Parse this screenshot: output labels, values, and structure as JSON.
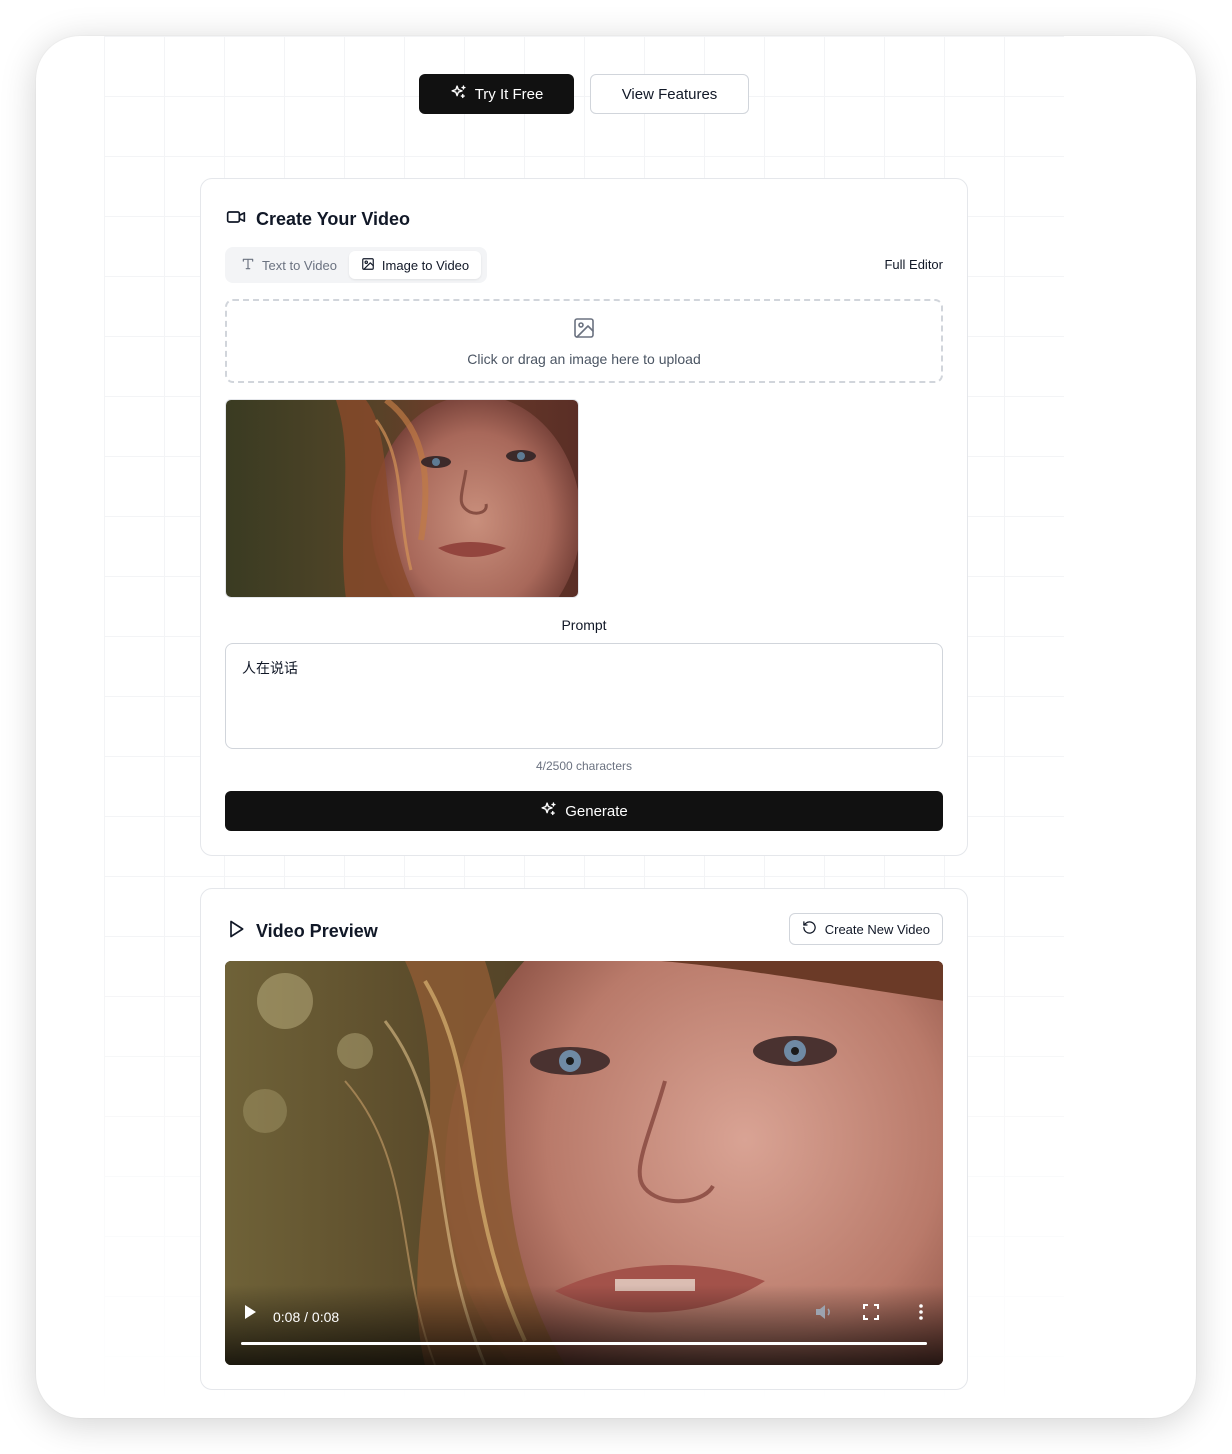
{
  "hero": {
    "try_free_label": "Try It Free",
    "view_features_label": "View Features"
  },
  "create_card": {
    "title": "Create Your Video",
    "tabs": [
      {
        "label": "Text to Video",
        "active": false
      },
      {
        "label": "Image to Video",
        "active": true
      }
    ],
    "full_editor_label": "Full Editor",
    "dropzone_text": "Click or drag an image here to upload",
    "prompt_label": "Prompt",
    "prompt_value": "人在说话",
    "char_count": "4/2500 characters",
    "generate_label": "Generate"
  },
  "preview_card": {
    "title": "Video Preview",
    "create_new_label": "Create New Video",
    "video": {
      "time": "0:08 / 0:08",
      "progress": 1.0
    }
  },
  "colors": {
    "primary_dark": "#111111",
    "border": "#e5e7eb",
    "muted_text": "#6b7280"
  },
  "icons": {
    "try_free": "sparkles-icon",
    "title_create": "video-camera-icon",
    "tab_text": "text-type-icon",
    "tab_image": "image-icon",
    "dropzone": "image-upload-icon",
    "generate": "sparkles-icon",
    "title_preview": "play-outline-icon",
    "create_new": "refresh-icon",
    "video_play": "play-icon",
    "video_volume": "volume-icon",
    "video_fullscreen": "fullscreen-icon",
    "video_more": "more-vertical-icon"
  }
}
